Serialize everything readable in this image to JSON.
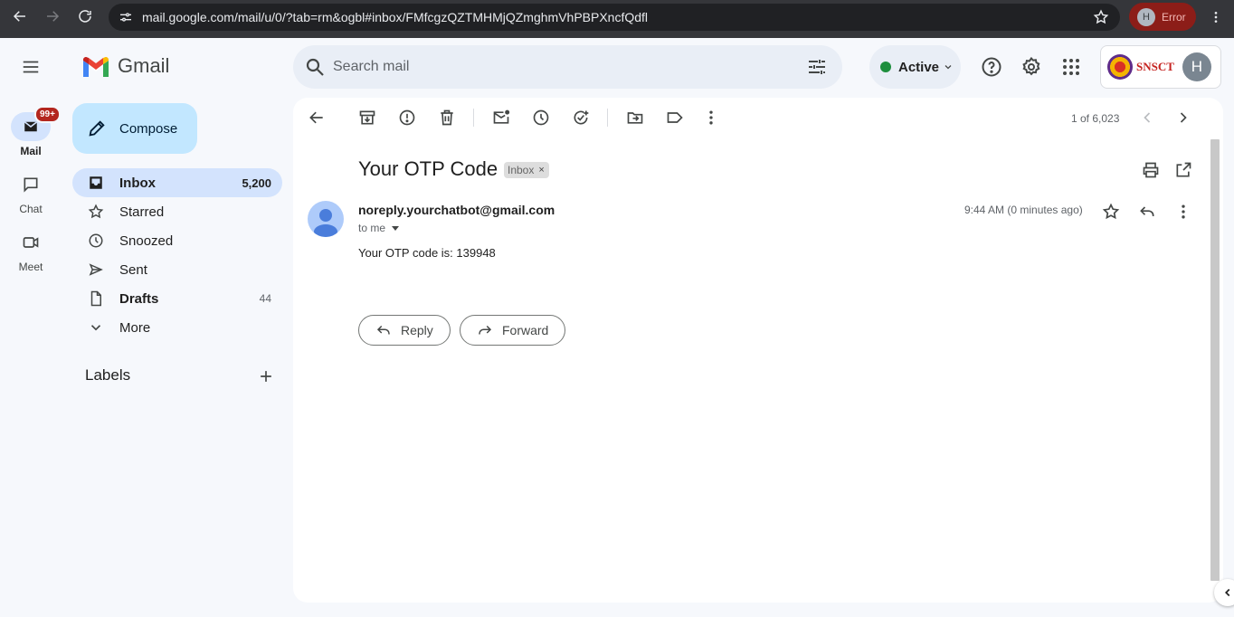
{
  "browser": {
    "url": "mail.google.com/mail/u/0/?tab=rm&ogbl#inbox/FMfcgzQZTMHMjQZmghmVhPBPXncfQdfl",
    "profile_initial": "H",
    "profile_status": "Error"
  },
  "header": {
    "app_name": "Gmail",
    "search_placeholder": "Search mail",
    "status_label": "Active",
    "org_name": "SNSCT",
    "user_initial": "H"
  },
  "rail": {
    "mail_label": "Mail",
    "mail_badge": "99+",
    "chat_label": "Chat",
    "meet_label": "Meet"
  },
  "sidebar": {
    "compose_label": "Compose",
    "items": [
      {
        "label": "Inbox",
        "count": "5,200",
        "icon": "inbox-icon"
      },
      {
        "label": "Starred",
        "count": "",
        "icon": "star-icon"
      },
      {
        "label": "Snoozed",
        "count": "",
        "icon": "clock-icon"
      },
      {
        "label": "Sent",
        "count": "",
        "icon": "send-icon"
      },
      {
        "label": "Drafts",
        "count": "44",
        "icon": "draft-icon"
      },
      {
        "label": "More",
        "count": "",
        "icon": "chevron-down-icon"
      }
    ],
    "labels_heading": "Labels"
  },
  "toolbar": {
    "pager": "1 of 6,023"
  },
  "message": {
    "subject": "Your OTP Code",
    "label_chip": "Inbox",
    "sender": "noreply.yourchatbot@gmail.com",
    "recipient": "to me",
    "time": "9:44 AM (0 minutes ago)",
    "body": "Your OTP code is: 139948",
    "reply_label": "Reply",
    "forward_label": "Forward"
  },
  "colors": {
    "accent": "#c2e7ff",
    "selected": "#d3e3fd",
    "active_dot": "#1e8e3e",
    "badge": "#b3261e"
  }
}
